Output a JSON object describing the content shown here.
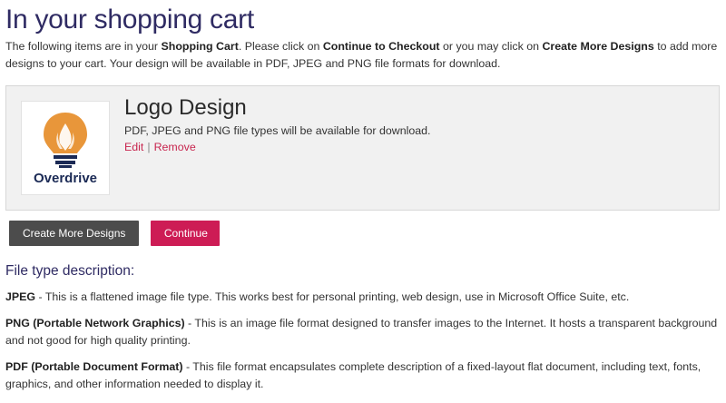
{
  "page": {
    "title": "In your shopping cart",
    "intro": {
      "t1": "The following items are in your ",
      "b1": "Shopping Cart",
      "t2": ". Please click on ",
      "b2": "Continue to Checkout",
      "t3": " or you may click on ",
      "b3": "Create More Designs",
      "t4": " to add more designs to your cart. Your design will be available in PDF, JPEG and PNG file formats for download."
    }
  },
  "cart": {
    "item": {
      "logo_text": "Overdrive",
      "logo_icon": "lightbulb-icon",
      "title": "Logo Design",
      "description": "PDF, JPEG and PNG file types will be available for download.",
      "edit_label": "Edit",
      "separator": "|",
      "remove_label": "Remove"
    }
  },
  "buttons": {
    "create_more": "Create More Designs",
    "continue": "Continue"
  },
  "file_types": {
    "heading": "File type description:",
    "items": [
      {
        "name": "JPEG",
        "text": " - This is a flattened image file type. This works best for personal printing, web design, use in Microsoft Office Suite, etc."
      },
      {
        "name": "PNG (Portable Network Graphics)",
        "text": " - This is an image file format designed to transfer images to the Internet. It hosts a transparent background and not good for high quality printing."
      },
      {
        "name": "PDF (Portable Document Format)",
        "text": " - This file format encapsulates complete description of a fixed-layout flat document, including text, fonts, graphics, and other information needed to display it."
      }
    ]
  },
  "colors": {
    "heading": "#2f2b63",
    "accent": "#cd1c55",
    "dark_button": "#4c4c4c",
    "logo_orange": "#e8963a",
    "logo_navy": "#1b2a55"
  }
}
